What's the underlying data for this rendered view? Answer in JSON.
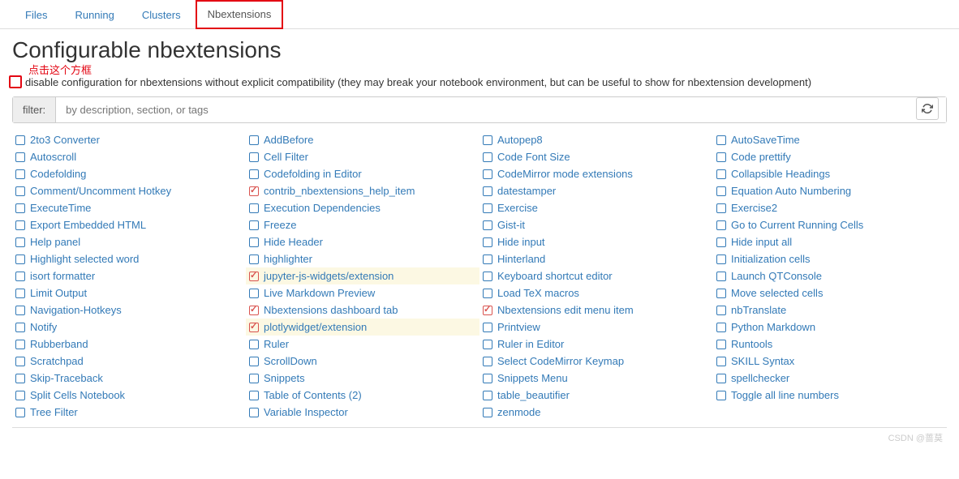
{
  "tabs": [
    {
      "label": "Files",
      "active": false,
      "highlighted": false
    },
    {
      "label": "Running",
      "active": false,
      "highlighted": false
    },
    {
      "label": "Clusters",
      "active": false,
      "highlighted": false
    },
    {
      "label": "Nbextensions",
      "active": true,
      "highlighted": true
    }
  ],
  "page_title": "Configurable nbextensions",
  "annotation_text": "点击这个方框",
  "compat_label": "disable configuration for nbextensions without explicit compatibility (they may break your notebook environment, but can be useful to show for nbextension development)",
  "filter": {
    "label": "filter:",
    "placeholder": "by description, section, or tags"
  },
  "extensions": {
    "col0": [
      {
        "label": "2to3 Converter",
        "checked": false,
        "selected": false
      },
      {
        "label": "Autoscroll",
        "checked": false,
        "selected": false
      },
      {
        "label": "Codefolding",
        "checked": false,
        "selected": false
      },
      {
        "label": "Comment/Uncomment Hotkey",
        "checked": false,
        "selected": false
      },
      {
        "label": "ExecuteTime",
        "checked": false,
        "selected": false
      },
      {
        "label": "Export Embedded HTML",
        "checked": false,
        "selected": false
      },
      {
        "label": "Help panel",
        "checked": false,
        "selected": false
      },
      {
        "label": "Highlight selected word",
        "checked": false,
        "selected": false
      },
      {
        "label": "isort formatter",
        "checked": false,
        "selected": false
      },
      {
        "label": "Limit Output",
        "checked": false,
        "selected": false
      },
      {
        "label": "Navigation-Hotkeys",
        "checked": false,
        "selected": false
      },
      {
        "label": "Notify",
        "checked": false,
        "selected": false
      },
      {
        "label": "Rubberband",
        "checked": false,
        "selected": false
      },
      {
        "label": "Scratchpad",
        "checked": false,
        "selected": false
      },
      {
        "label": "Skip-Traceback",
        "checked": false,
        "selected": false
      },
      {
        "label": "Split Cells Notebook",
        "checked": false,
        "selected": false
      },
      {
        "label": "Tree Filter",
        "checked": false,
        "selected": false
      }
    ],
    "col1": [
      {
        "label": "AddBefore",
        "checked": false,
        "selected": false
      },
      {
        "label": "Cell Filter",
        "checked": false,
        "selected": false
      },
      {
        "label": "Codefolding in Editor",
        "checked": false,
        "selected": false
      },
      {
        "label": "contrib_nbextensions_help_item",
        "checked": true,
        "selected": false
      },
      {
        "label": "Execution Dependencies",
        "checked": false,
        "selected": false
      },
      {
        "label": "Freeze",
        "checked": false,
        "selected": false
      },
      {
        "label": "Hide Header",
        "checked": false,
        "selected": false
      },
      {
        "label": "highlighter",
        "checked": false,
        "selected": false
      },
      {
        "label": "jupyter-js-widgets/extension",
        "checked": true,
        "selected": true
      },
      {
        "label": "Live Markdown Preview",
        "checked": false,
        "selected": false
      },
      {
        "label": "Nbextensions dashboard tab",
        "checked": true,
        "selected": false
      },
      {
        "label": "plotlywidget/extension",
        "checked": true,
        "selected": true
      },
      {
        "label": "Ruler",
        "checked": false,
        "selected": false
      },
      {
        "label": "ScrollDown",
        "checked": false,
        "selected": false
      },
      {
        "label": "Snippets",
        "checked": false,
        "selected": false
      },
      {
        "label": "Table of Contents (2)",
        "checked": false,
        "selected": false
      },
      {
        "label": "Variable Inspector",
        "checked": false,
        "selected": false
      }
    ],
    "col2": [
      {
        "label": "Autopep8",
        "checked": false,
        "selected": false
      },
      {
        "label": "Code Font Size",
        "checked": false,
        "selected": false
      },
      {
        "label": "CodeMirror mode extensions",
        "checked": false,
        "selected": false
      },
      {
        "label": "datestamper",
        "checked": false,
        "selected": false
      },
      {
        "label": "Exercise",
        "checked": false,
        "selected": false
      },
      {
        "label": "Gist-it",
        "checked": false,
        "selected": false
      },
      {
        "label": "Hide input",
        "checked": false,
        "selected": false
      },
      {
        "label": "Hinterland",
        "checked": false,
        "selected": false
      },
      {
        "label": "Keyboard shortcut editor",
        "checked": false,
        "selected": false
      },
      {
        "label": "Load TeX macros",
        "checked": false,
        "selected": false
      },
      {
        "label": "Nbextensions edit menu item",
        "checked": true,
        "selected": false
      },
      {
        "label": "Printview",
        "checked": false,
        "selected": false
      },
      {
        "label": "Ruler in Editor",
        "checked": false,
        "selected": false
      },
      {
        "label": "Select CodeMirror Keymap",
        "checked": false,
        "selected": false
      },
      {
        "label": "Snippets Menu",
        "checked": false,
        "selected": false
      },
      {
        "label": "table_beautifier",
        "checked": false,
        "selected": false
      },
      {
        "label": "zenmode",
        "checked": false,
        "selected": false
      }
    ],
    "col3": [
      {
        "label": "AutoSaveTime",
        "checked": false,
        "selected": false
      },
      {
        "label": "Code prettify",
        "checked": false,
        "selected": false
      },
      {
        "label": "Collapsible Headings",
        "checked": false,
        "selected": false
      },
      {
        "label": "Equation Auto Numbering",
        "checked": false,
        "selected": false
      },
      {
        "label": "Exercise2",
        "checked": false,
        "selected": false
      },
      {
        "label": "Go to Current Running Cells",
        "checked": false,
        "selected": false
      },
      {
        "label": "Hide input all",
        "checked": false,
        "selected": false
      },
      {
        "label": "Initialization cells",
        "checked": false,
        "selected": false
      },
      {
        "label": "Launch QTConsole",
        "checked": false,
        "selected": false
      },
      {
        "label": "Move selected cells",
        "checked": false,
        "selected": false
      },
      {
        "label": "nbTranslate",
        "checked": false,
        "selected": false
      },
      {
        "label": "Python Markdown",
        "checked": false,
        "selected": false
      },
      {
        "label": "Runtools",
        "checked": false,
        "selected": false
      },
      {
        "label": "SKILL Syntax",
        "checked": false,
        "selected": false
      },
      {
        "label": "spellchecker",
        "checked": false,
        "selected": false
      },
      {
        "label": "Toggle all line numbers",
        "checked": false,
        "selected": false
      }
    ]
  },
  "watermark": "CSDN @蔷莫"
}
